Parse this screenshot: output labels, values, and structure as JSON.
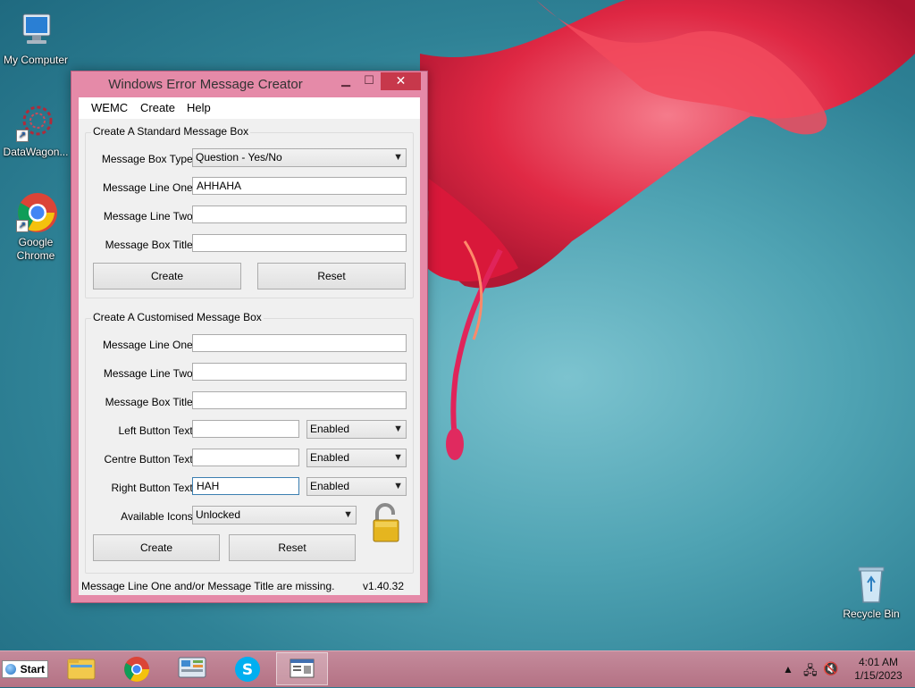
{
  "desktop": {
    "icons": [
      {
        "label": "My Computer"
      },
      {
        "label": "DataWagon..."
      },
      {
        "label": "Google Chrome"
      },
      {
        "label": "Recycle Bin"
      }
    ]
  },
  "window": {
    "title": "Windows Error Message Creator",
    "menu": [
      "WEMC",
      "Create",
      "Help"
    ],
    "standard": {
      "group_title": "Create A Standard Message Box",
      "type_label": "Message Box Type:",
      "type_value": "Question - Yes/No",
      "line1_label": "Message Line One:",
      "line1_value": "AHHAHA",
      "line2_label": "Message Line Two:",
      "line2_value": "",
      "title_label": "Message Box Title:",
      "title_value": "",
      "create_label": "Create",
      "reset_label": "Reset"
    },
    "custom": {
      "group_title": "Create A Customised Message Box",
      "line1_label": "Message Line One:",
      "line1_value": "",
      "line2_label": "Message Line Two:",
      "line2_value": "",
      "title_label": "Message Box Title:",
      "title_value": "",
      "left_label": "Left Button Text:",
      "left_value": "",
      "left_state": "Enabled",
      "centre_label": "Centre Button Text:",
      "centre_value": "",
      "centre_state": "Enabled",
      "right_label": "Right Button Text:",
      "right_value": "HAH",
      "right_state": "Enabled",
      "icons_label": "Available Icons:",
      "icons_value": "Unlocked",
      "create_label": "Create",
      "reset_label": "Reset"
    },
    "status": {
      "message": "Message Line One and/or Message Title are missing.",
      "version": "v1.40.32"
    }
  },
  "taskbar": {
    "start_label": "Start",
    "time": "4:01 AM",
    "date": "1/15/2023"
  }
}
